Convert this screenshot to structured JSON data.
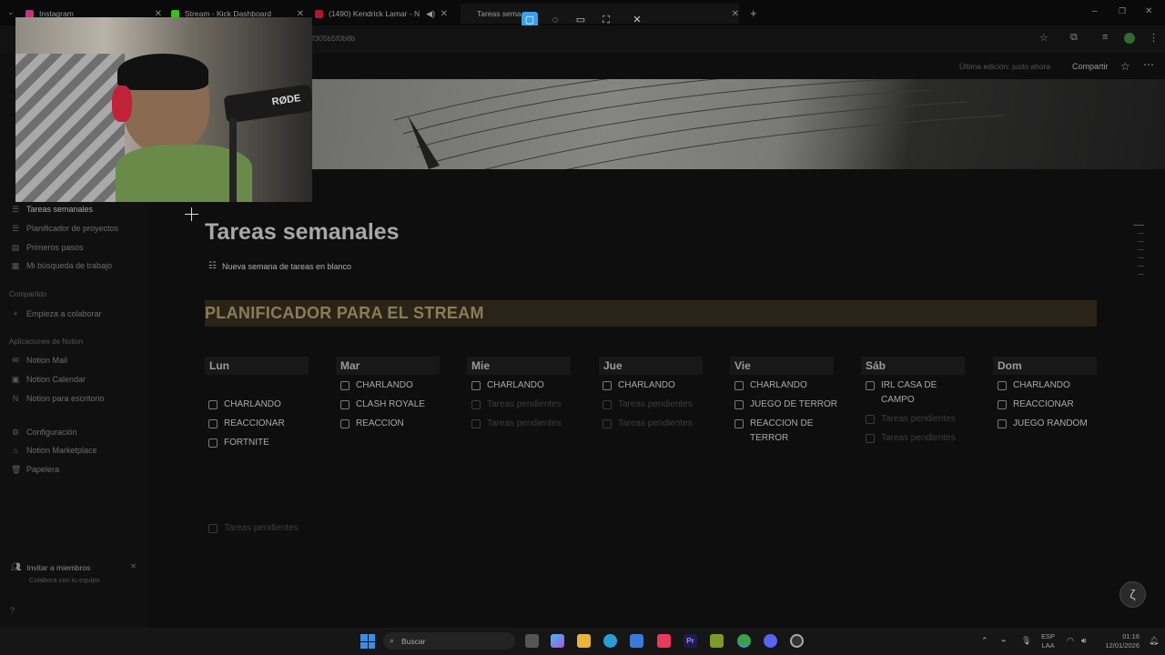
{
  "browser": {
    "tabs": [
      {
        "label": "Instagram",
        "color": "#c13584"
      },
      {
        "label": "Stream - Kick Dashboard",
        "color": "#53fc18"
      },
      {
        "label": "(1490) Kendrick Lamar - N",
        "color": "#ff0033"
      },
      {
        "label": "Tareas sema",
        "color": "#e0e0e0"
      }
    ],
    "url": "f305b5f0b8b"
  },
  "capture_toolbar": {
    "icons": [
      "rect-select-icon",
      "freeform-select-icon",
      "window-select-icon",
      "fullscreen-select-icon",
      "close-icon"
    ]
  },
  "header": {
    "last_edit": "Última edición: justo ahora",
    "share": "Compartir"
  },
  "sidebar": {
    "items": [
      {
        "label": "Tareas semanales",
        "icon": "list-icon"
      },
      {
        "label": "Planificador de proyectos",
        "icon": "list-icon"
      },
      {
        "label": "Primeros pasos",
        "icon": "page-icon"
      },
      {
        "label": "Mi búsqueda de trabajo",
        "icon": "grid-icon"
      }
    ],
    "shared_heading": "Compartido",
    "shared_item": "Empieza a colaborar",
    "apps_heading": "Aplicaciones de Notion",
    "apps": [
      "Notion Mail",
      "Notion Calendar",
      "Notion para escritorio"
    ],
    "bottom": [
      "Configuración",
      "Notion Marketplace",
      "Papelera"
    ],
    "invite_title": "Invitar a miembros",
    "invite_sub": "Colabora con tu equipo"
  },
  "page": {
    "title": "Tareas semanales",
    "template_button": "Nueva semana de tareas en blanco",
    "banner": "PLANIFICADOR PARA EL STREAM",
    "days": [
      {
        "name": "Lun",
        "tasks": [
          "CHARLANDO",
          "REACCIONAR",
          "FORTNITE"
        ],
        "pending": []
      },
      {
        "name": "Mar",
        "tasks": [
          "CHARLANDO",
          "CLASH ROYALE",
          "REACCION"
        ],
        "pending": []
      },
      {
        "name": "Mie",
        "tasks": [
          "CHARLANDO"
        ],
        "pending": [
          "Tareas pendientes",
          "Tareas pendientes"
        ]
      },
      {
        "name": "Jue",
        "tasks": [
          "CHARLANDO"
        ],
        "pending": [
          "Tareas pendientes",
          "Tareas pendientes"
        ]
      },
      {
        "name": "Vie",
        "tasks": [
          "CHARLANDO",
          "JUEGO DE TERROR",
          "REACCION DE TERROR"
        ],
        "pending": []
      },
      {
        "name": "Sáb",
        "tasks": [
          "IRL CASA DE CAMPO"
        ],
        "pending": [
          "Tareas pendientes",
          "Tareas pendientes"
        ]
      },
      {
        "name": "Dom",
        "tasks": [
          "CHARLANDO",
          "REACCIONAR",
          "JUEGO RANDOM"
        ],
        "pending": []
      }
    ],
    "footer_pending": "Tareas pendientes"
  },
  "webcam": {
    "mic_label": "RØDE"
  },
  "taskbar": {
    "search": "Buscar",
    "lang": "ESP",
    "lang2": "LAA",
    "time": "01:16",
    "date": "12/01/2026"
  }
}
